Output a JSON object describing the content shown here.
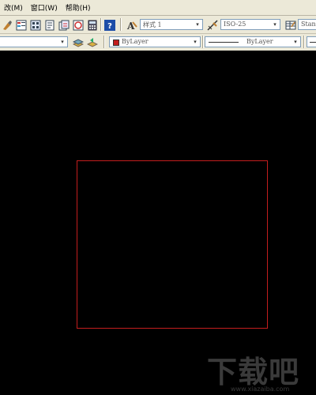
{
  "menu": {
    "items": [
      "改(M)",
      "窗口(W)",
      "帮助(H)"
    ]
  },
  "toolbar": {
    "text_style": "样式 1",
    "dim_style": "ISO-25",
    "table_style": "Stan",
    "color_value": "ByLayer",
    "linetype_value": "ByLayer"
  },
  "colors": {
    "rectangle": "#c41e1e",
    "canvas": "#000000"
  },
  "watermark": {
    "text": "下载吧",
    "url": "www.xiazaiba.com"
  }
}
